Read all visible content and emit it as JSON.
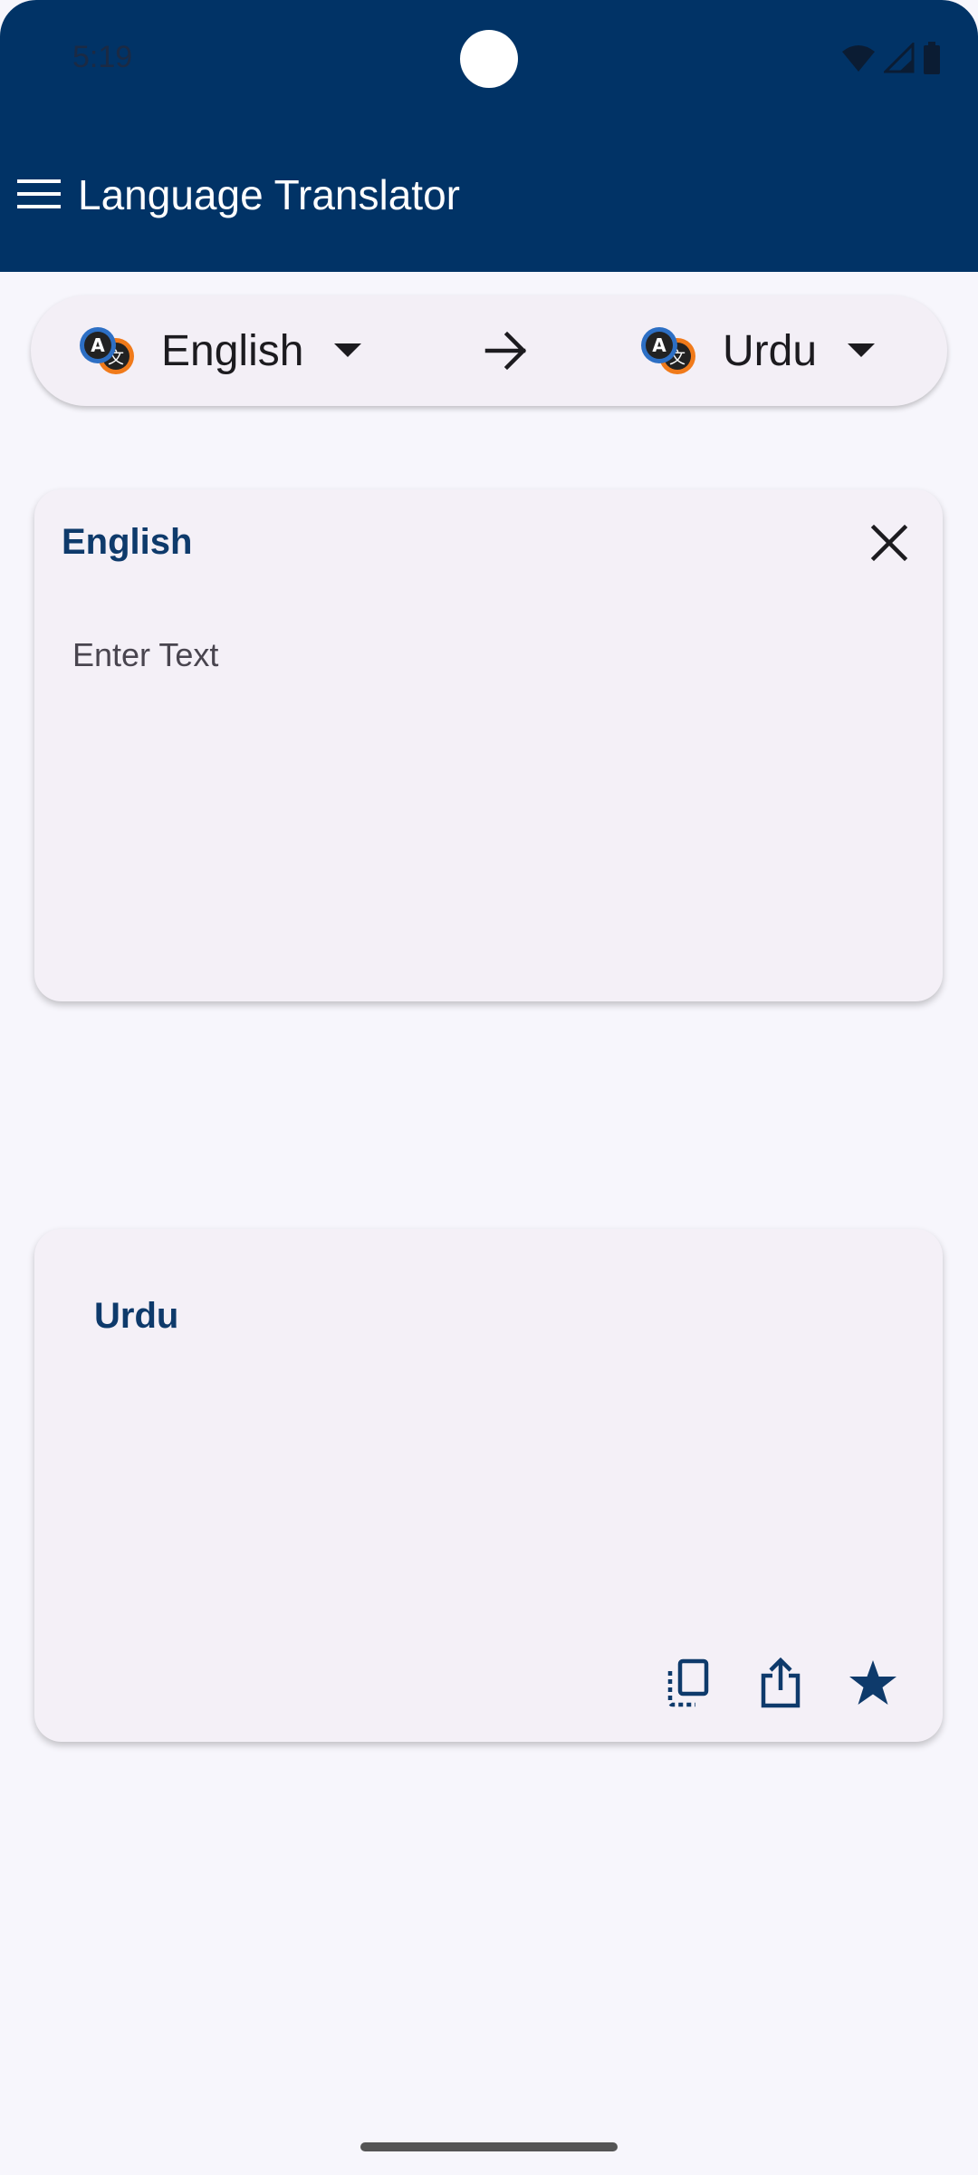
{
  "status_bar": {
    "time": "5:19"
  },
  "app_bar": {
    "title": "Language Translator"
  },
  "language_selector": {
    "source_language": "English",
    "target_language": "Urdu"
  },
  "input_card": {
    "language_label": "English",
    "placeholder": "Enter Text",
    "value": ""
  },
  "output_card": {
    "language_label": "Urdu"
  },
  "colors": {
    "primary": "#013366",
    "background": "#f7f6fc",
    "card": "#f4f0f7",
    "accent_orange": "#f07a1a"
  },
  "icons": [
    "menu-icon",
    "translate-icon",
    "dropdown-arrow-icon",
    "arrow-right-icon",
    "close-icon",
    "copy-icon",
    "share-icon",
    "star-icon"
  ]
}
